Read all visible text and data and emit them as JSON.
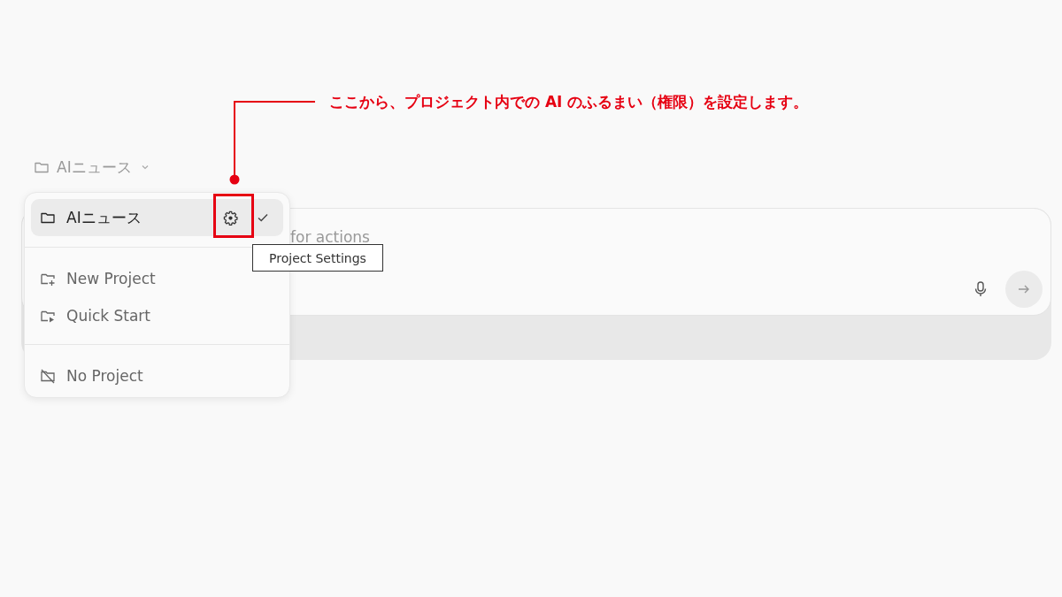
{
  "project_selector": {
    "label": "AIニュース"
  },
  "composer": {
    "placeholder": "for actions"
  },
  "menu": {
    "projects": [
      {
        "label": "AIニュース",
        "selected": true
      }
    ],
    "actions": [
      {
        "kind": "new",
        "label": "New Project"
      },
      {
        "kind": "quick",
        "label": "Quick Start"
      }
    ],
    "no_project": {
      "label": "No Project"
    }
  },
  "tooltip": {
    "text": "Project Settings"
  },
  "annotation": {
    "text": "ここから、プロジェクト内での AI のふるまい（権限）を設定します。"
  }
}
